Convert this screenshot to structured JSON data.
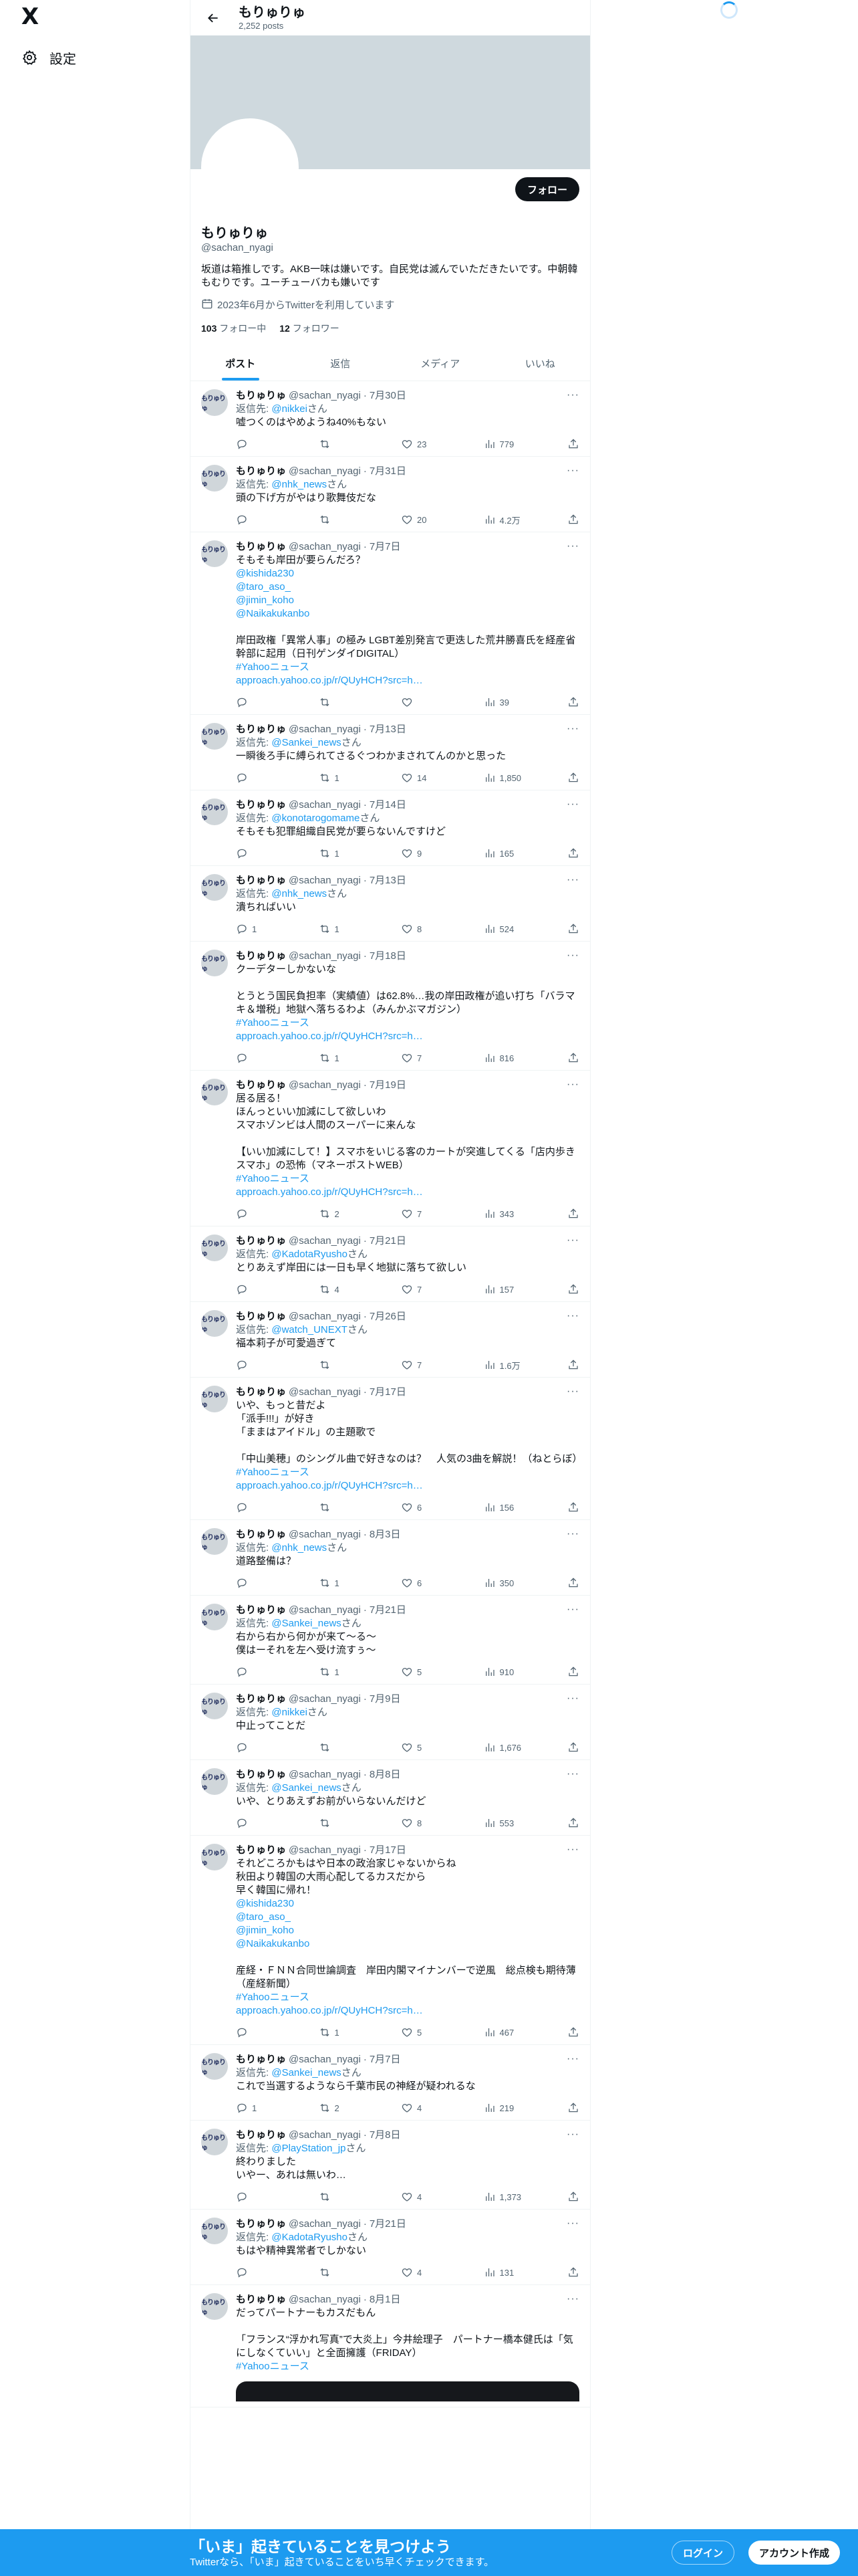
{
  "nav": {
    "logo": "X",
    "settings_label": "設定"
  },
  "header": {
    "name": "もりゅりゅ",
    "post_count": "2,252 posts"
  },
  "profile": {
    "name": "もりゅりゅ",
    "handle": "@sachan_nyagi",
    "bio": "坂道は箱推しです。AKB一味は嫌いです。自民党は滅んでいただきたいです。中朝韓もむりです。ユーチューバカも嫌いです",
    "joined": "2023年6月からTwitterを利用しています",
    "following_count": "103",
    "following_label": "フォロー中",
    "followers_count": "12",
    "followers_label": "フォロワー",
    "follow_button": "フォロー"
  },
  "tabs": [
    "ポスト",
    "返信",
    "メディア",
    "いいね"
  ],
  "tweets": [
    {
      "name": "もりゅりゅ",
      "handle": "@sachan_nyagi",
      "date": "7月30日",
      "reply_prefix": "返信先: ",
      "reply_to": "@nikkei",
      "reply_suffix": "さん",
      "text": "嘘つくのはやめようね40%もない",
      "replies": "",
      "retweets": "",
      "likes": "23",
      "views": "779"
    },
    {
      "name": "もりゅりゅ",
      "handle": "@sachan_nyagi",
      "date": "7月31日",
      "reply_prefix": "返信先: ",
      "reply_to": "@nhk_news",
      "reply_suffix": "さん",
      "text": "頭の下げ方がやはり歌舞伎だな",
      "replies": "",
      "retweets": "",
      "likes": "20",
      "views": "4.2万"
    },
    {
      "name": "もりゅりゅ",
      "handle": "@sachan_nyagi",
      "date": "7月7日",
      "reply_prefix": "",
      "reply_to": "",
      "reply_suffix": "",
      "text": "そもそも岸田が要らんだろ？",
      "links": "@kishida230\n@taro_aso_\n@jimin_koho\n@Naikakukanbo",
      "text2": "岸田政権「異常人事」の極み LGBT差別発言で更迭した荒井勝喜氏を経産省幹部に起用（日刊ゲンダイDIGITAL）",
      "tag": "#Yahooニュース",
      "url": "approach.yahoo.co.jp/r/QUyHCH?src=h…",
      "replies": "",
      "retweets": "",
      "likes": "",
      "views": "39"
    },
    {
      "name": "もりゅりゅ",
      "handle": "@sachan_nyagi",
      "date": "7月13日",
      "reply_prefix": "返信先: ",
      "reply_to": "@Sankei_news",
      "reply_suffix": "さん",
      "text": "一瞬後ろ手に縛られてさるぐつわかまされてんのかと思った",
      "replies": "",
      "retweets": "1",
      "likes": "14",
      "views": "1,850"
    },
    {
      "name": "もりゅりゅ",
      "handle": "@sachan_nyagi",
      "date": "7月14日",
      "reply_prefix": "返信先: ",
      "reply_to": "@konotarogomame",
      "reply_suffix": "さん",
      "text": "そもそも犯罪組織自民党が要らないんですけど",
      "replies": "",
      "retweets": "1",
      "likes": "9",
      "views": "165"
    },
    {
      "name": "もりゅりゅ",
      "handle": "@sachan_nyagi",
      "date": "7月13日",
      "reply_prefix": "返信先: ",
      "reply_to": "@nhk_news",
      "reply_suffix": "さん",
      "text": "潰ちればいい",
      "replies": "1",
      "retweets": "1",
      "likes": "8",
      "views": "524"
    },
    {
      "name": "もりゅりゅ",
      "handle": "@sachan_nyagi",
      "date": "7月18日",
      "reply_prefix": "",
      "reply_to": "",
      "reply_suffix": "",
      "text": "クーデターしかないな",
      "links": "",
      "text2": "とうとう国民負担率（実績値）は62.8%…我の岸田政権が追い打ち「バラマキ＆増税」地獄へ落ちるわよ（みんかぶマガジン）",
      "tag": "#Yahooニュース",
      "url": "approach.yahoo.co.jp/r/QUyHCH?src=h…",
      "replies": "",
      "retweets": "1",
      "likes": "7",
      "views": "816"
    },
    {
      "name": "もりゅりゅ",
      "handle": "@sachan_nyagi",
      "date": "7月19日",
      "reply_prefix": "",
      "reply_to": "",
      "reply_suffix": "",
      "text": "居る居る！\nほんっといい加減にして欲しいわ\nスマホゾンビは人間のスーパーに来んな",
      "links": "",
      "text2": "【いい加減にして！】スマホをいじる客のカートが突進してくる「店内歩きスマホ」の恐怖（マネーポストWEB）",
      "tag": "#Yahooニュース",
      "url": "approach.yahoo.co.jp/r/QUyHCH?src=h…",
      "replies": "",
      "retweets": "2",
      "likes": "7",
      "views": "343"
    },
    {
      "name": "もりゅりゅ",
      "handle": "@sachan_nyagi",
      "date": "7月21日",
      "reply_prefix": "返信先: ",
      "reply_to": "@KadotaRyusho",
      "reply_suffix": "さん",
      "text": "とりあえず岸田には一日も早く地獄に落ちて欲しい",
      "replies": "",
      "retweets": "4",
      "likes": "7",
      "views": "157"
    },
    {
      "name": "もりゅりゅ",
      "handle": "@sachan_nyagi",
      "date": "7月26日",
      "reply_prefix": "返信先: ",
      "reply_to": "@watch_UNEXT",
      "reply_suffix": "さん",
      "text": "福本莉子が可愛過ぎて",
      "replies": "",
      "retweets": "",
      "likes": "7",
      "views": "1.6万"
    },
    {
      "name": "もりゅりゅ",
      "handle": "@sachan_nyagi",
      "date": "7月17日",
      "reply_prefix": "",
      "reply_to": "",
      "reply_suffix": "",
      "text": "いや、もっと昔だよ\n「派手!!!」が好き\n「ままはアイドル」の主題歌で",
      "links": "",
      "text2": "「中山美穂」のシングル曲で好きなのは？　人気の3曲を解説！（ねとらぼ）",
      "tag": "#Yahooニュース",
      "url": "approach.yahoo.co.jp/r/QUyHCH?src=h…",
      "replies": "",
      "retweets": "",
      "likes": "6",
      "views": "156"
    },
    {
      "name": "もりゅりゅ",
      "handle": "@sachan_nyagi",
      "date": "8月3日",
      "reply_prefix": "返信先: ",
      "reply_to": "@nhk_news",
      "reply_suffix": "さん",
      "text": "道路整備は？",
      "replies": "",
      "retweets": "1",
      "likes": "6",
      "views": "350"
    },
    {
      "name": "もりゅりゅ",
      "handle": "@sachan_nyagi",
      "date": "7月21日",
      "reply_prefix": "返信先: ",
      "reply_to": "@Sankei_news",
      "reply_suffix": "さん",
      "text": "右から右から何かが来て〜る〜\n僕はーそれを左へ受け流すぅ〜",
      "replies": "",
      "retweets": "1",
      "likes": "5",
      "views": "910"
    },
    {
      "name": "もりゅりゅ",
      "handle": "@sachan_nyagi",
      "date": "7月9日",
      "reply_prefix": "返信先: ",
      "reply_to": "@nikkei",
      "reply_suffix": "さん",
      "text": "中止ってことだ",
      "replies": "",
      "retweets": "",
      "likes": "5",
      "views": "1,676"
    },
    {
      "name": "もりゅりゅ",
      "handle": "@sachan_nyagi",
      "date": "8月8日",
      "reply_prefix": "返信先: ",
      "reply_to": "@Sankei_news",
      "reply_suffix": "さん",
      "text": "いや、とりあえずお前がいらないんだけど",
      "replies": "",
      "retweets": "",
      "likes": "8",
      "views": "553"
    },
    {
      "name": "もりゅりゅ",
      "handle": "@sachan_nyagi",
      "date": "7月17日",
      "reply_prefix": "",
      "reply_to": "",
      "reply_suffix": "",
      "text": "それどころかもはや日本の政治家じゃないからね\n秋田より韓国の大雨心配してるカスだから\n早く韓国に帰れ！",
      "links": "@kishida230\n@taro_aso_\n@jimin_koho\n@Naikakukanbo",
      "text2": "産経・ＦＮＮ合同世論調査　岸田内閣マイナンバーで逆風　総点検も期待薄（産経新聞）",
      "tag": "#Yahooニュース",
      "url": "approach.yahoo.co.jp/r/QUyHCH?src=h…",
      "replies": "",
      "retweets": "1",
      "likes": "5",
      "views": "467"
    },
    {
      "name": "もりゅりゅ",
      "handle": "@sachan_nyagi",
      "date": "7月7日",
      "reply_prefix": "返信先: ",
      "reply_to": "@Sankei_news",
      "reply_suffix": "さん",
      "text": "これで当選するようなら千葉市民の神経が疑われるな",
      "replies": "1",
      "retweets": "2",
      "likes": "4",
      "views": "219"
    },
    {
      "name": "もりゅりゅ",
      "handle": "@sachan_nyagi",
      "date": "7月8日",
      "reply_prefix": "返信先: ",
      "reply_to": "@PlayStation_jp",
      "reply_suffix": "さん",
      "text": "終わりました\nいやー、あれは無いわ…",
      "replies": "",
      "retweets": "",
      "likes": "4",
      "views": "1,373"
    },
    {
      "name": "もりゅりゅ",
      "handle": "@sachan_nyagi",
      "date": "7月21日",
      "reply_prefix": "返信先: ",
      "reply_to": "@KadotaRyusho",
      "reply_suffix": "さん",
      "text": "もはや精神異常者でしかない",
      "replies": "",
      "retweets": "",
      "likes": "4",
      "views": "131"
    },
    {
      "name": "もりゅりゅ",
      "handle": "@sachan_nyagi",
      "date": "8月1日",
      "reply_prefix": "",
      "reply_to": "",
      "reply_suffix": "",
      "text": "だってパートナーもカスだもん",
      "links": "",
      "text2": "「フランス“浮かれ写真”で大炎上」今井絵理子　パートナー橋本健氏は「気にしなくていい」と全面擁護（FRIDAY）",
      "tag": "#Yahooニュース",
      "url": "",
      "replies": "",
      "retweets": "",
      "likes": "",
      "views": "",
      "media": true
    }
  ],
  "avatar_text": "もりゅりゅ",
  "bottom": {
    "title": "「いま」起きていることを見つけよう",
    "subtitle": "Twitterなら、「いま」起きていることをいち早くチェックできます。",
    "login": "ログイン",
    "signup": "アカウント作成"
  }
}
